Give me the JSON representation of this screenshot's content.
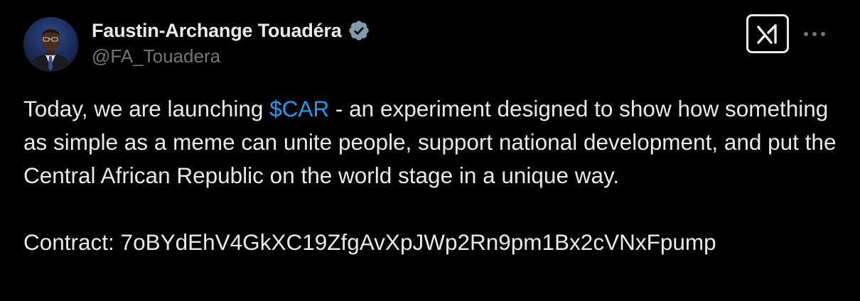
{
  "tweet": {
    "author": {
      "display_name": "Faustin-Archange Touadéra",
      "handle": "@FA_Touadera",
      "verified": true,
      "verified_color": "#71767b"
    },
    "body": {
      "part1": "Today, we are launching ",
      "cashtag": "$CAR",
      "part2": " - an experiment designed to show how something as simple as a meme can unite people, support national development, and put the Central African Republic on the world stage in a unique way.",
      "contract": "Contract: 7oBYdEhV4GkXC19ZfgAvXpJWp2Rn9pm1Bx2cVNxFpump"
    },
    "actions": {
      "grok_icon": "grok-icon",
      "more_icon": "more-options-icon"
    },
    "colors": {
      "background": "#000000",
      "text": "#e7e9ea",
      "secondary_text": "#71767b",
      "link": "#1d9bf0"
    }
  }
}
